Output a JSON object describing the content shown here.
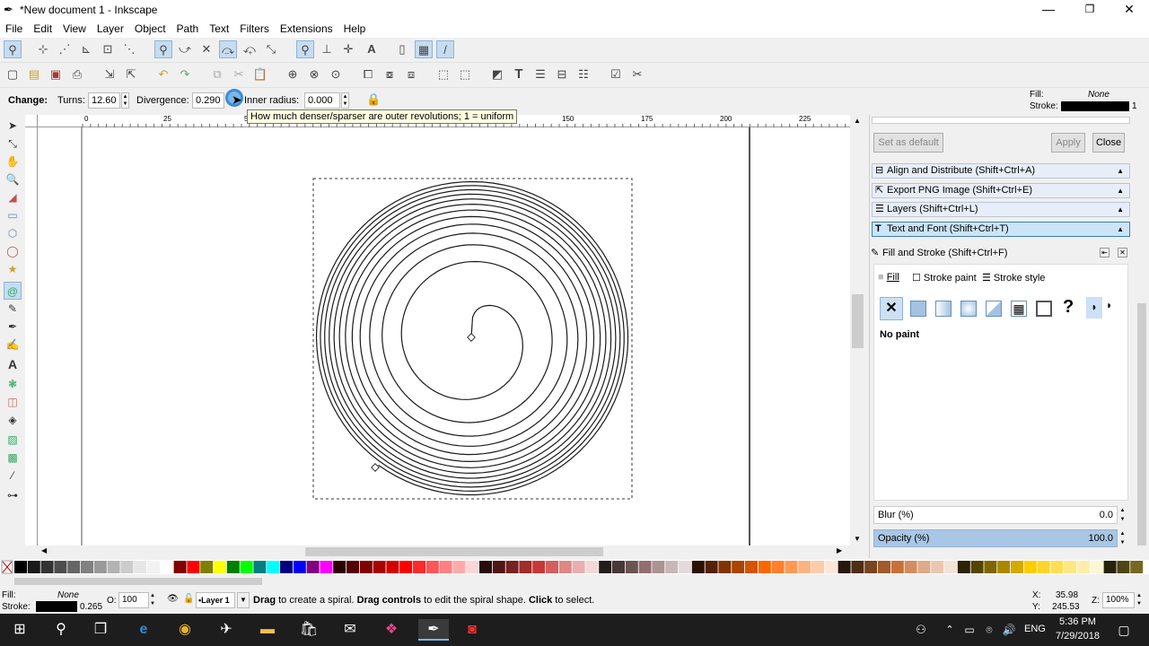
{
  "window": {
    "title": "*New document 1 - Inkscape",
    "app_icon": "inkscape-icon"
  },
  "menu": [
    "File",
    "Edit",
    "View",
    "Layer",
    "Object",
    "Path",
    "Text",
    "Filters",
    "Extensions",
    "Help"
  ],
  "spiral": {
    "change_label": "Change:",
    "turns_label": "Turns:",
    "turns_value": "12.60",
    "divergence_label": "Divergence:",
    "divergence_value": "0.290",
    "inner_radius_label": "Inner radius:",
    "inner_radius_value": "0.000"
  },
  "tooltip": "How much denser/sparser are outer revolutions; 1 = uniform",
  "ruler": {
    "marks": [
      "0",
      "25",
      "50",
      "75",
      "100",
      "125",
      "150",
      "175",
      "200",
      "225"
    ]
  },
  "style_indicator": {
    "fill_label": "Fill:",
    "fill_value": "None",
    "stroke_label": "Stroke:",
    "stroke_width": "1"
  },
  "dock": {
    "set_default": "Set as default",
    "apply": "Apply",
    "close": "Close",
    "dialogs": [
      "Align and Distribute (Shift+Ctrl+A)",
      "Export PNG Image (Shift+Ctrl+E)",
      "Layers (Shift+Ctrl+L)",
      "Text and Font (Shift+Ctrl+T)"
    ],
    "fill_stroke_title": "Fill and Stroke (Shift+Ctrl+F)",
    "tabs": [
      "Fill",
      "Stroke paint",
      "Stroke style"
    ],
    "no_paint": "No paint",
    "blur_label": "Blur (%)",
    "blur_value": "0.0",
    "opacity_label": "Opacity (%)",
    "opacity_value": "100.0"
  },
  "status": {
    "fill_label": "Fill:",
    "fill_value": "None",
    "stroke_label": "Stroke:",
    "stroke_width": "0.265",
    "opacity_label": "O:",
    "opacity_value": "100",
    "layer": "•Layer 1",
    "message_bold1": "Drag",
    "message_1": " to create a spiral. ",
    "message_bold2": "Drag controls",
    "message_2": " to edit the spiral shape. ",
    "message_bold3": "Click",
    "message_3": " to select.",
    "x_label": "X:",
    "x_value": "35.98",
    "y_label": "Y:",
    "y_value": "245.53",
    "zoom_label": "Z:",
    "zoom_value": "100%"
  },
  "taskbar": {
    "time": "5:36 PM",
    "date": "7/29/2018",
    "lang": "ENG"
  },
  "colors": {
    "accent": "#3c7fb1",
    "taskbar": "#1d1d1d"
  }
}
